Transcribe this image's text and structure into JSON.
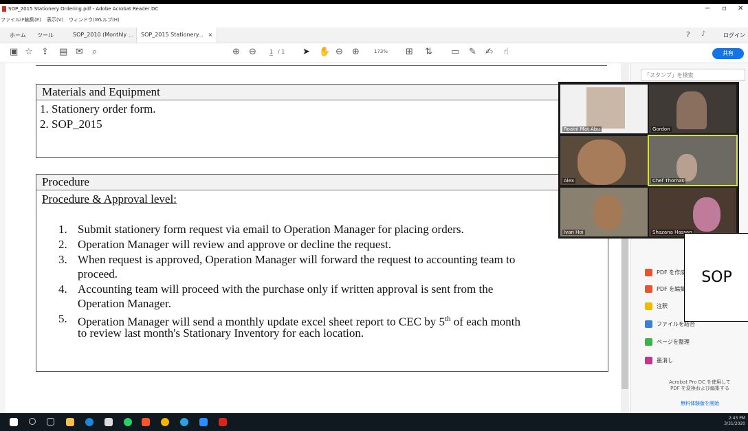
{
  "window": {
    "title": "SOP_2015 Stationery Ordering.pdf - Adobe Acrobat Reader DC",
    "menu": [
      "ファイル(F)",
      "編集(E)",
      "表示(V)",
      "ウィンドウ(W)",
      "ヘルプ(H)"
    ]
  },
  "tabs": {
    "home": "ホーム",
    "tools": "ツール",
    "tab1": "SOP_2010 (Monthly ...",
    "tab2": "SOP_2015 Stationery...",
    "login": "ログイン"
  },
  "toolbar": {
    "page_current": "1",
    "page_total": "/ 1",
    "zoom": "173%",
    "share": "共有"
  },
  "document": {
    "materials": {
      "heading": "Materials and Equipment",
      "items": [
        "1.  Stationery order form.",
        "2.  SOP_2015"
      ]
    },
    "procedure": {
      "heading": "Procedure",
      "subheading": "Procedure & Approval level:",
      "items": [
        {
          "num": "1.",
          "lines": [
            "Submit stationery form request via email to Operation Manager for placing orders."
          ]
        },
        {
          "num": "2.",
          "lines": [
            "Operation Manager will review and approve or decline the request."
          ]
        },
        {
          "num": "3.",
          "lines": [
            "When request is approved, Operation Manager will forward the request to accounting team to",
            "proceed."
          ]
        },
        {
          "num": "4.",
          "lines": [
            "Accounting team will proceed with the purchase only if written approval is sent from the",
            "Operation Manager."
          ]
        },
        {
          "num": "5.",
          "line1_a": "Operation Manager will send a monthly update excel sheet report to CEC by 5",
          "line1_sup": "th",
          "line1_b": " of each month",
          "line2": "to review last month's Stationary Inventory for each location."
        }
      ]
    }
  },
  "right_panel": {
    "search_placeholder": "「スタンプ」を検索",
    "tools": [
      "PDF を作成",
      "PDF を編集",
      "注釈",
      "ファイルを結合",
      "ページを整理",
      "墨消し"
    ],
    "promo_line1": "Acrobat Pro DC を使用して",
    "promo_line2": "PDF を変換および編集する",
    "trial": "無料体験版を開始"
  },
  "video": {
    "participants": [
      "Roaini Mat Abu",
      "Gordon",
      "Alex",
      "Chef Thomas",
      "Ivan Hoi",
      "Shazana Hassan"
    ],
    "overlay_label": "SOP"
  },
  "taskbar": {
    "time": "2:43 PM",
    "date": "3/31/2020"
  }
}
